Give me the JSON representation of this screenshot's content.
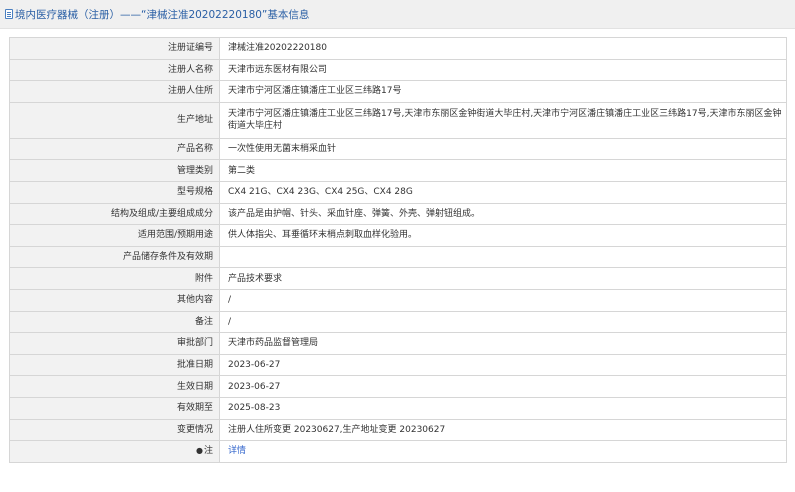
{
  "page": {
    "title": "境内医疗器械（注册）——“津械注准20202220180”基本信息"
  },
  "fields": [
    {
      "label": "注册证编号",
      "value": "津械注准20202220180"
    },
    {
      "label": "注册人名称",
      "value": "天津市远东医材有限公司"
    },
    {
      "label": "注册人住所",
      "value": "天津市宁河区潘庄镇潘庄工业区三纬路17号"
    },
    {
      "label": "生产地址",
      "value": "天津市宁河区潘庄镇潘庄工业区三纬路17号,天津市东丽区金钟街道大毕庄村,天津市宁河区潘庄镇潘庄工业区三纬路17号,天津市东丽区金钟街道大毕庄村"
    },
    {
      "label": "产品名称",
      "value": "一次性使用无菌末梢采血针"
    },
    {
      "label": "管理类别",
      "value": "第二类"
    },
    {
      "label": "型号规格",
      "value": "CX4 21G、CX4 23G、CX4 25G、CX4 28G"
    },
    {
      "label": "结构及组成/主要组成成分",
      "value": "该产品是由护帽、针头、采血针座、弹簧、外壳、弹射钮组成。"
    },
    {
      "label": "适用范围/预期用途",
      "value": "供人体指尖、耳垂循环末梢点刺取血样化验用。"
    },
    {
      "label": "产品储存条件及有效期",
      "value": ""
    },
    {
      "label": "附件",
      "value": "产品技术要求"
    },
    {
      "label": "其他内容",
      "value": "/"
    },
    {
      "label": "备注",
      "value": "/"
    },
    {
      "label": "审批部门",
      "value": "天津市药品监督管理局"
    },
    {
      "label": "批准日期",
      "value": "2023-06-27"
    },
    {
      "label": "生效日期",
      "value": "2023-06-27"
    },
    {
      "label": "有效期至",
      "value": "2025-08-23"
    },
    {
      "label": "变更情况",
      "value": "注册人住所变更 20230627,生产地址变更 20230627"
    }
  ],
  "note_row": {
    "label": "注",
    "icon": "bell-icon",
    "link_text": "详情"
  },
  "colors": {
    "title": "#2a5fa5",
    "link": "#3366cc",
    "label_bg": "#f2f2f2",
    "border": "#d6d6d6"
  }
}
